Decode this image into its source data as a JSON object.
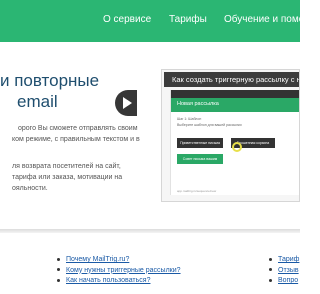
{
  "nav": {
    "items": [
      "О сервисе",
      "Тарифы",
      "Обучение и помо"
    ]
  },
  "hero": {
    "headline_lines": [
      "и повторные",
      "email"
    ],
    "para1_lines": [
      "орого Вы сможете отправлять своим",
      "ком режиме, с правильным текстом и в"
    ],
    "para2_lines": [
      "ля возврата посетителей на сайт,",
      "тарифа или заказа, мотивации на",
      "ояльности."
    ]
  },
  "video": {
    "title": "Как создать триггерную рассылку с нул",
    "screen": {
      "header": "Новая рассылка",
      "step": "Шаг 1: Шаблон",
      "hint": "Выберите шаблон для вашей рассылки",
      "buttons": [
        "Приветственные письма",
        "Брошенная корзина",
        "Совет письма вашим"
      ],
      "footer": "app.mailtrig.ru/sequence/new"
    }
  },
  "footer": {
    "left_links": [
      "Почему MailTrig.ru?",
      "Кому нужны триггерные рассылки?",
      "Как начать пользоваться?"
    ],
    "right_links": [
      "Тариф",
      "Отзыв",
      "Вопро"
    ]
  },
  "colors": {
    "nav_green": "#2bb673",
    "headline_blue": "#1f4e6e",
    "link_blue": "#1a5aa6"
  }
}
